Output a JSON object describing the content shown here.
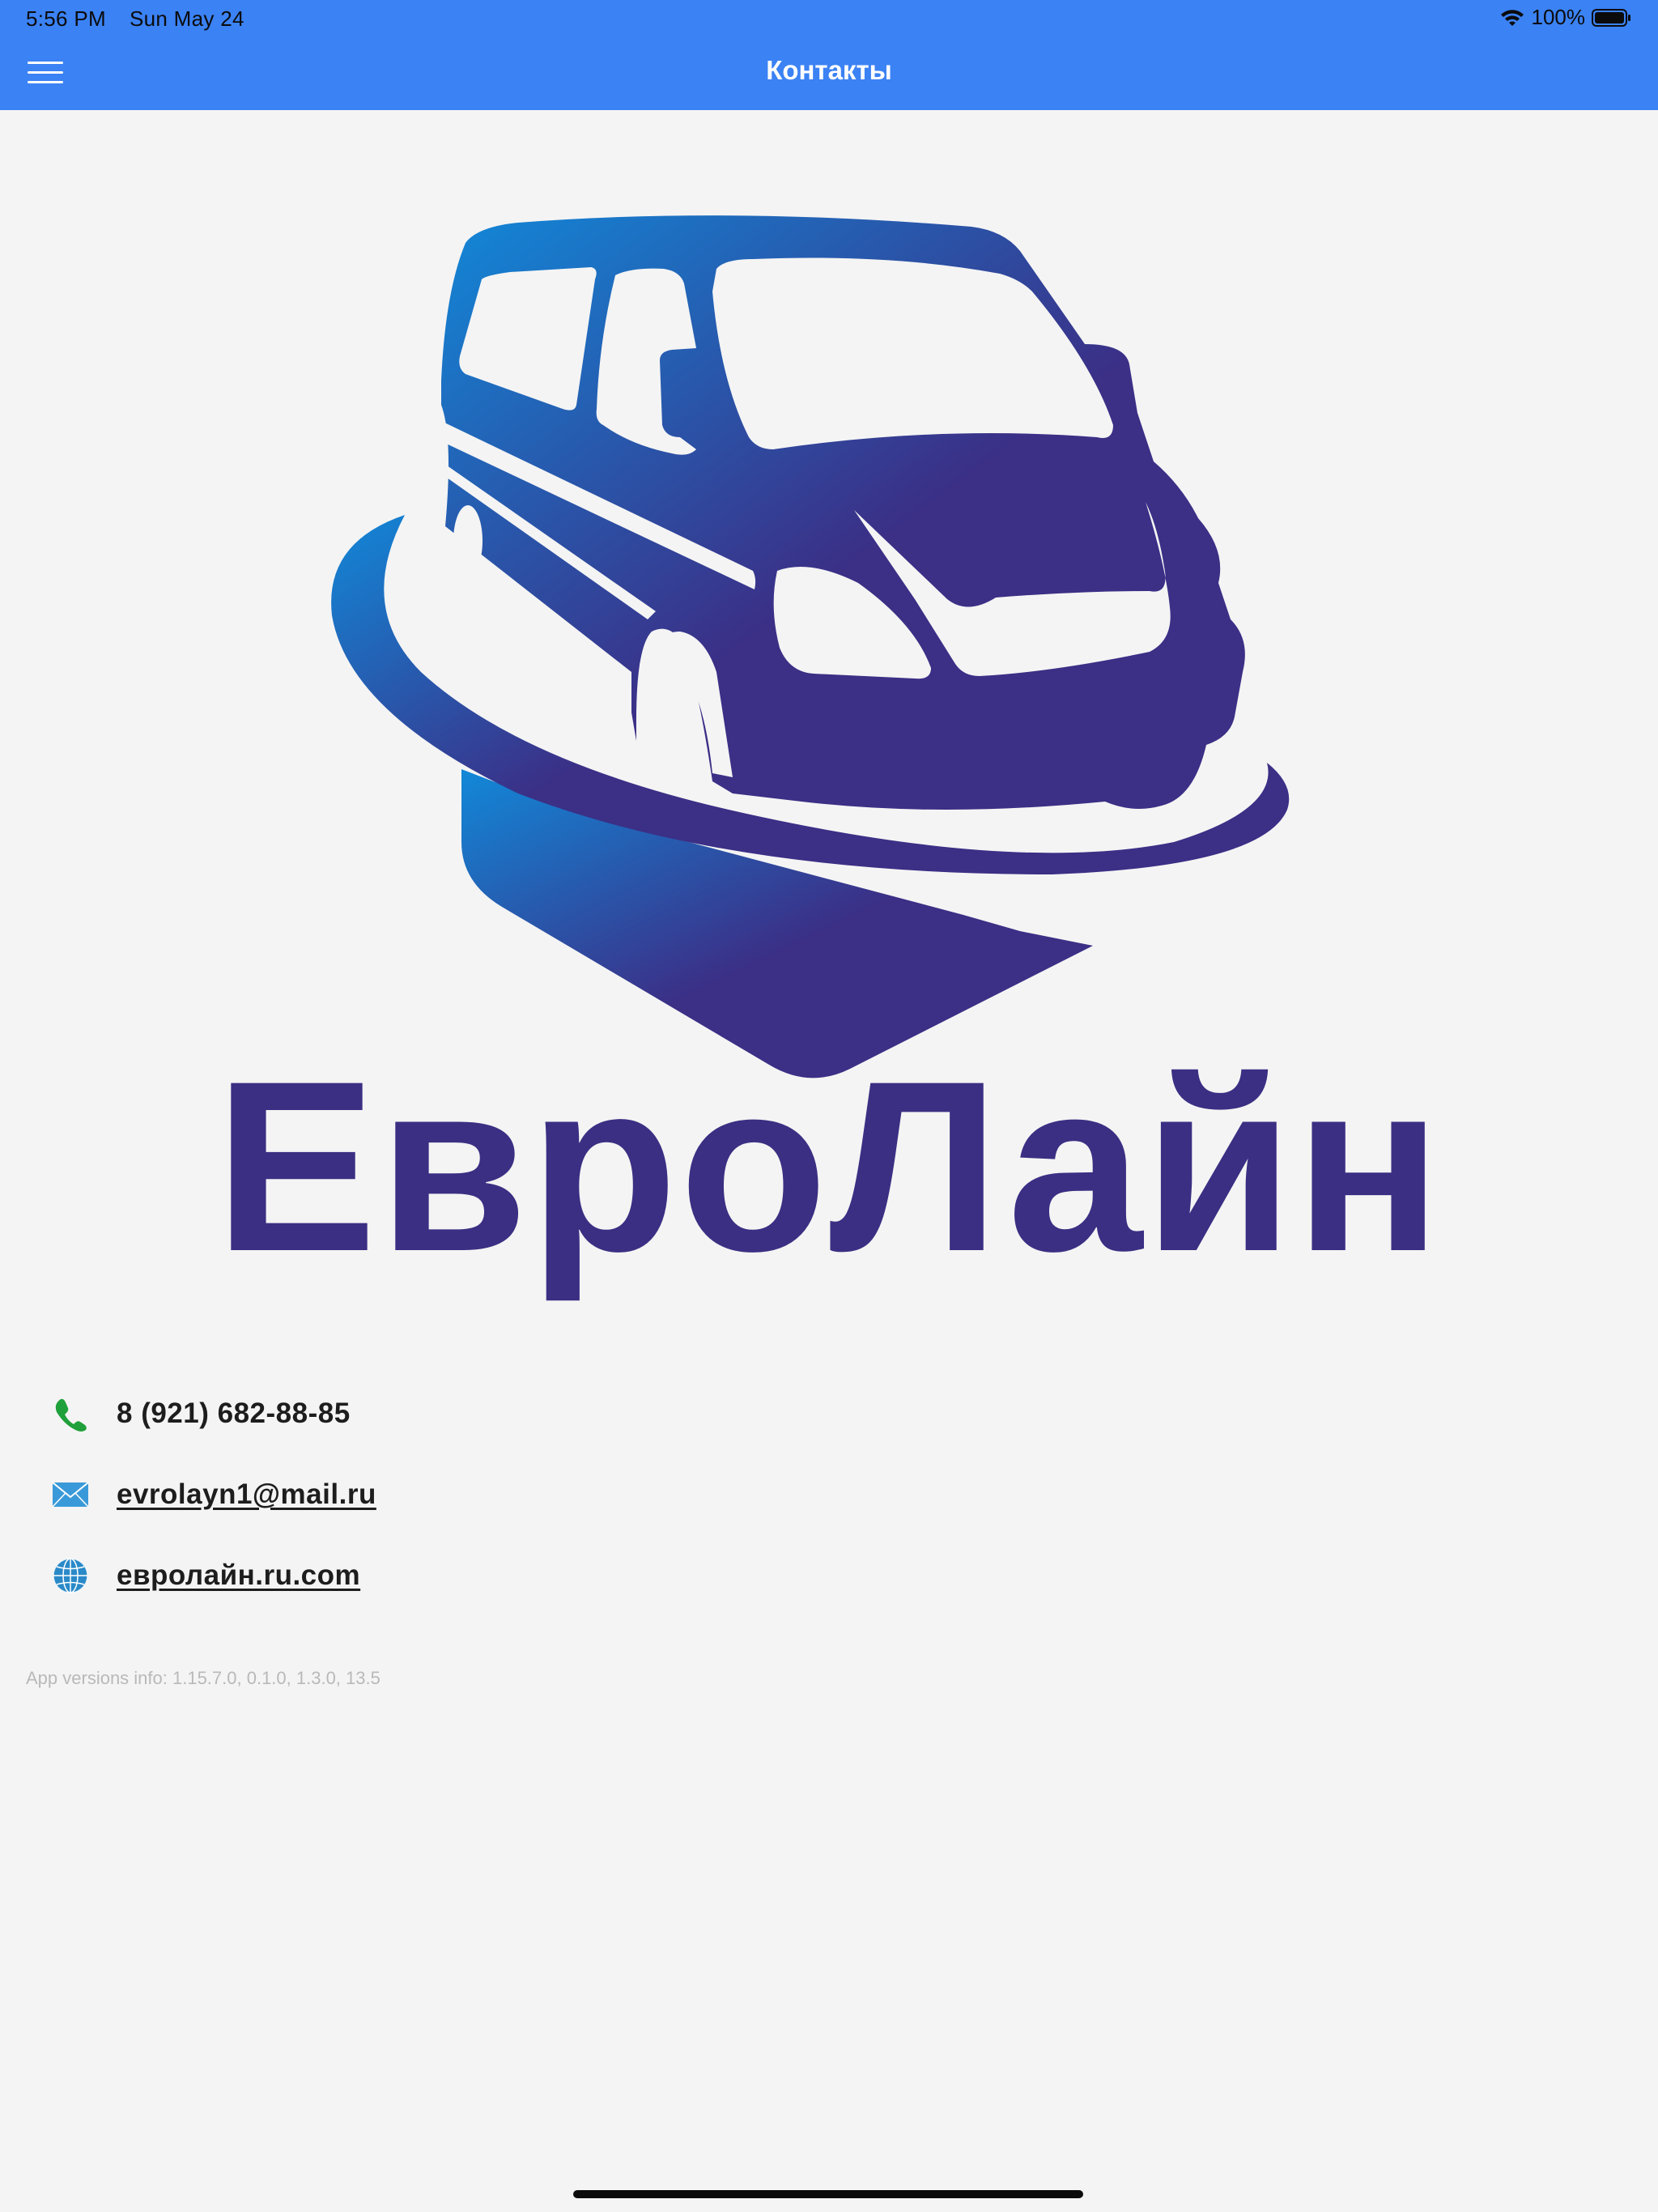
{
  "status_bar": {
    "time": "5:56 PM",
    "date": "Sun May 24",
    "battery": "100%"
  },
  "header": {
    "title": "Контакты"
  },
  "logo": {
    "brand_text": "ЕвроЛайн",
    "colors": {
      "gradient_start": "#1288d8",
      "gradient_end": "#3b2f86",
      "text": "#3a2f83"
    }
  },
  "contacts": {
    "phone": "8 (921) 682-88-85",
    "email": "evrolayn1@mail.ru",
    "website": "евролайн.ru.com"
  },
  "footer": {
    "version_info": "App versions info: 1.15.7.0, 0.1.0, 1.3.0, 13.5"
  },
  "colors": {
    "header_bg": "#3b82f4",
    "page_bg": "#f4f4f4",
    "phone_icon": "#1fa03a",
    "mail_icon": "#3a9ad9",
    "globe_icon": "#2a89c8"
  }
}
